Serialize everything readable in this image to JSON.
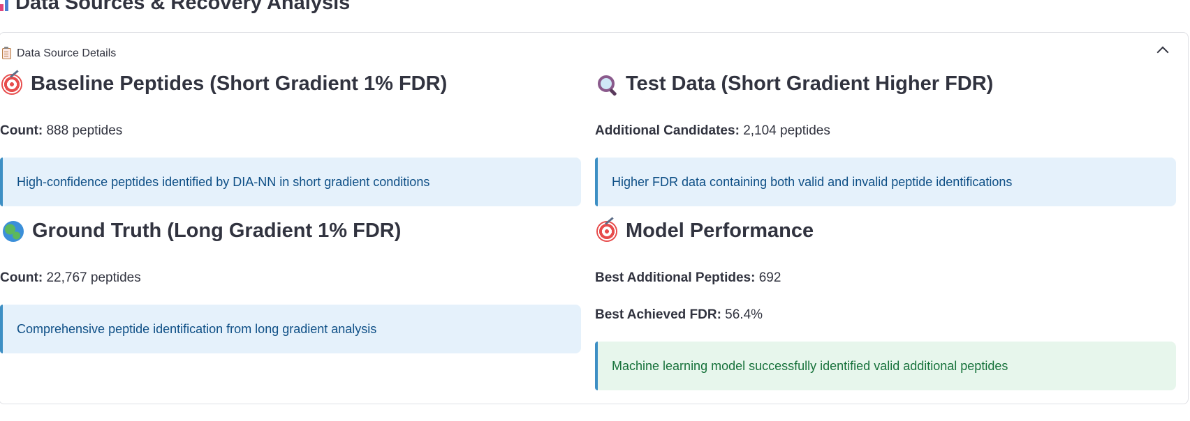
{
  "page_title": "Data Sources & Recovery Analysis",
  "expander": {
    "label": "Data Source Details",
    "expanded": true
  },
  "baseline": {
    "title": "Baseline Peptides (Short Gradient 1% FDR)",
    "count_label": "Count:",
    "count_value": "888 peptides",
    "info": "High-confidence peptides identified by DIA-NN in short gradient conditions"
  },
  "test": {
    "title": "Test Data (Short Gradient Higher FDR)",
    "count_label": "Additional Candidates:",
    "count_value": "2,104 peptides",
    "info": "Higher FDR data containing both valid and invalid peptide identifications"
  },
  "ground_truth": {
    "title": "Ground Truth (Long Gradient 1% FDR)",
    "count_label": "Count:",
    "count_value": "22,767 peptides",
    "info": "Comprehensive peptide identification from long gradient analysis"
  },
  "model": {
    "title": "Model Performance",
    "peptides_label": "Best Additional Peptides:",
    "peptides_value": "692",
    "fdr_label": "Best Achieved FDR:",
    "fdr_value": "56.4%",
    "success": "Machine learning model successfully identified valid additional peptides"
  },
  "colors": {
    "info_bg": "#e5f1fb",
    "info_text": "#0e4f86",
    "success_bg": "#e7f6ec",
    "success_text": "#17723b",
    "accent_border": "#3d8fc4"
  },
  "icons": {
    "title": "bar-chart-icon",
    "expander": "clipboard-icon",
    "baseline": "target-icon",
    "test": "magnifier-icon",
    "ground_truth": "globe-icon",
    "model": "target-icon",
    "toggle": "chevron-up-icon"
  }
}
